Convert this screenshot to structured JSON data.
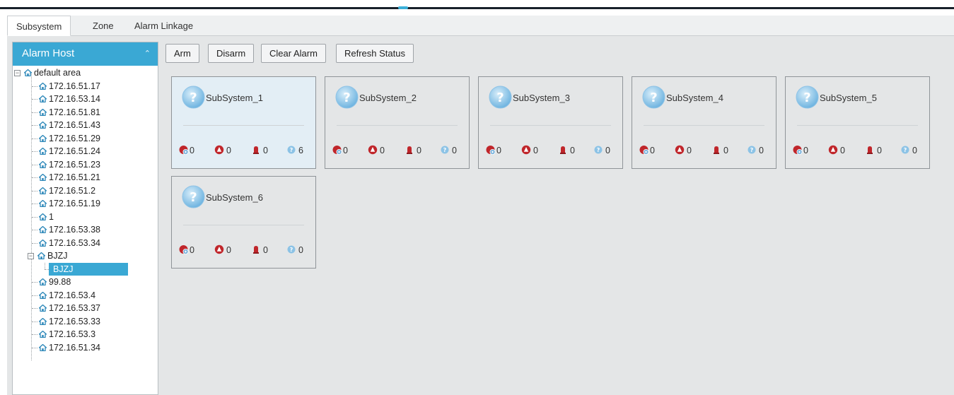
{
  "tabs": [
    {
      "label": "Subsystem",
      "active": true
    },
    {
      "label": "Zone",
      "active": false
    },
    {
      "label": "Alarm Linkage",
      "active": false
    }
  ],
  "sidebar": {
    "title": "Alarm Host",
    "tree": {
      "root": "default area",
      "hosts_a": [
        "172.16.51.17",
        "172.16.53.14",
        "172.16.51.81",
        "172.16.51.43",
        "172.16.51.29",
        "172.16.51.24",
        "172.16.51.23",
        "172.16.51.21",
        "172.16.51.2",
        "172.16.51.19",
        "1",
        "172.16.53.38",
        "172.16.53.34"
      ],
      "group": "BJZJ",
      "group_child": "BJZJ",
      "hosts_b": [
        "99.88",
        "172.16.53.4",
        "172.16.53.37",
        "172.16.53.33",
        "172.16.53.3",
        "172.16.51.34"
      ]
    }
  },
  "toolbar": {
    "arm": "Arm",
    "disarm": "Disarm",
    "clear_alarm": "Clear Alarm",
    "refresh_status": "Refresh Status"
  },
  "subsystems": [
    {
      "name": "SubSystem_1",
      "bypass": "0",
      "alarm": "0",
      "siren": "0",
      "unknown": "6",
      "highlighted": true
    },
    {
      "name": "SubSystem_2",
      "bypass": "0",
      "alarm": "0",
      "siren": "0",
      "unknown": "0",
      "highlighted": false
    },
    {
      "name": "SubSystem_3",
      "bypass": "0",
      "alarm": "0",
      "siren": "0",
      "unknown": "0",
      "highlighted": false
    },
    {
      "name": "SubSystem_4",
      "bypass": "0",
      "alarm": "0",
      "siren": "0",
      "unknown": "0",
      "highlighted": false
    },
    {
      "name": "SubSystem_5",
      "bypass": "0",
      "alarm": "0",
      "siren": "0",
      "unknown": "0",
      "highlighted": false
    },
    {
      "name": "SubSystem_6",
      "bypass": "0",
      "alarm": "0",
      "siren": "0",
      "unknown": "0",
      "highlighted": false
    }
  ],
  "icons": {
    "status_unknown": "question-circle-icon",
    "stat_bypass": "bypass-icon",
    "stat_alarm": "alarm-icon",
    "stat_siren": "siren-icon",
    "stat_unknown": "unknown-icon",
    "tree_node": "home-icon"
  },
  "colors": {
    "accent": "#3aa8d4",
    "alarm_red": "#c0262b",
    "unknown_blue": "#8cc3e6"
  }
}
